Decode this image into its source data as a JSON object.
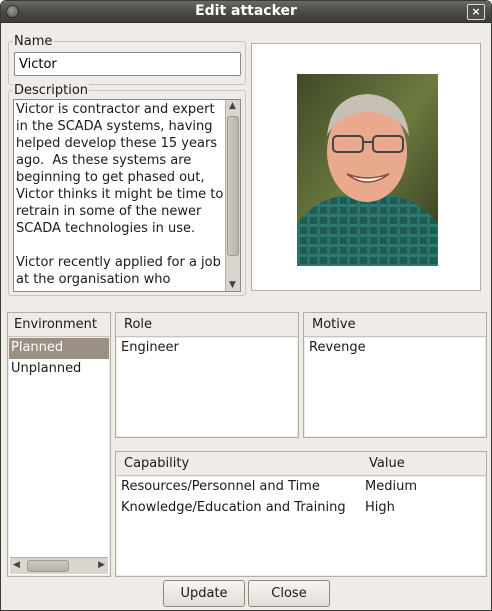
{
  "window": {
    "title": "Edit attacker",
    "close_glyph": "×",
    "menu_icon": "window-menu-icon"
  },
  "name": {
    "label": "Name",
    "value": "Victor"
  },
  "description": {
    "label": "Description",
    "text": "Victor is contractor and expert in the SCADA systems, having helped develop these 15 years ago.  As these systems are beginning to get phased out, Victor thinks it might be time to retrain in some of the newer SCADA technologies in use.\n\nVictor recently applied for a job at the organisation who"
  },
  "photo": {
    "icon": "attacker-photo"
  },
  "environment": {
    "header": "Environment",
    "items": [
      "Planned",
      "Unplanned"
    ],
    "selected": 0
  },
  "role": {
    "header": "Role",
    "items": [
      "Engineer"
    ]
  },
  "motive": {
    "header": "Motive",
    "items": [
      "Revenge"
    ]
  },
  "capability": {
    "headers": [
      "Capability",
      "Value"
    ],
    "rows": [
      [
        "Resources/Personnel and Time",
        "Medium"
      ],
      [
        "Knowledge/Education and Training",
        "High"
      ]
    ]
  },
  "buttons": {
    "update": "Update",
    "close": "Close"
  },
  "colors": {
    "selection": "#9c8f84",
    "titlebar": "#4a4945"
  }
}
